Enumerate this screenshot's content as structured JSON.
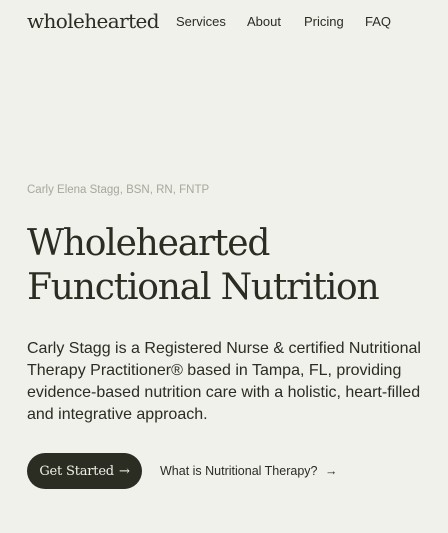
{
  "header": {
    "logo": "wholehearted",
    "nav": [
      "Services",
      "About",
      "Pricing",
      "FAQ"
    ]
  },
  "hero": {
    "eyebrow": "Carly Elena Stagg, BSN, RN, FNTP",
    "headline_line1": "Wholehearted",
    "headline_line2": "Functional Nutrition",
    "intro": "Carly Stagg is a Registered Nurse & certified Nutritional Therapy Practitioner® based in Tampa, FL, providing evidence-based nutrition care with a holistic, heart-filled and integrative approach.",
    "cta_label": "Get Started",
    "secondary_link": "What is Nutritional Therapy?",
    "arrow_glyph": "→"
  },
  "colors": {
    "background": "#eff1ea",
    "text": "#2b2c22",
    "muted": "#a6a99b",
    "button_bg": "#2b2c22"
  }
}
